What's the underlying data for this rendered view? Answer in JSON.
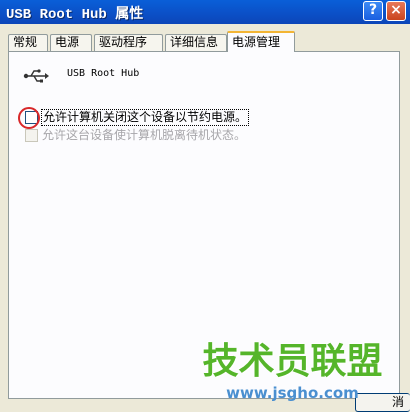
{
  "window": {
    "title": "USB Root Hub 属性",
    "help_label": "?",
    "close_label": "×"
  },
  "tabs": [
    {
      "label": "常规"
    },
    {
      "label": "电源"
    },
    {
      "label": "驱动程序"
    },
    {
      "label": "详细信息"
    },
    {
      "label": "电源管理"
    }
  ],
  "active_tab": "电源管理",
  "device": {
    "icon": "usb-icon",
    "name": "USB Root Hub"
  },
  "options": [
    {
      "label": "允许计算机关闭这个设备以节约电源。",
      "checked": false,
      "enabled": true
    },
    {
      "label": "允许这台设备使计算机脱离待机状态。",
      "checked": false,
      "enabled": false
    }
  ],
  "bottom_button": {
    "label": "消"
  },
  "watermark": {
    "main": "技术员联盟",
    "url": "www.jsgho.com"
  },
  "colors": {
    "titlebar": "#0b4fc6",
    "active_tab_accent": "#f3b534",
    "highlight_ring": "#d8282a",
    "watermark_green": "#55b52a",
    "watermark_blue": "#4a8fd0"
  }
}
